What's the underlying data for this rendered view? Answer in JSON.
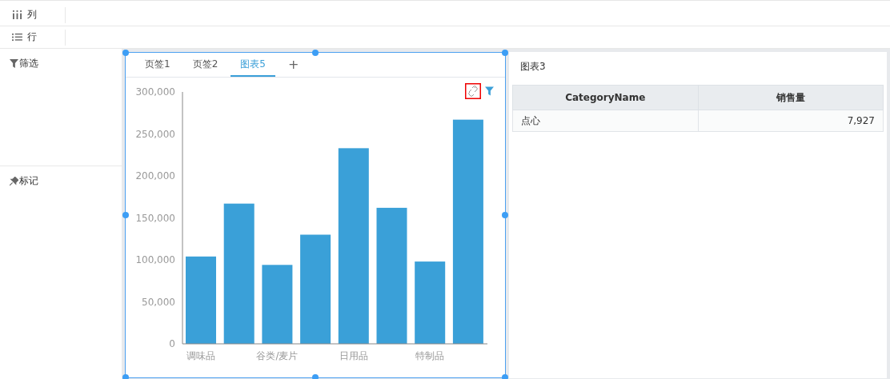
{
  "shelves": [
    {
      "kind": "columns",
      "label": "列"
    },
    {
      "kind": "rows",
      "label": "行"
    }
  ],
  "side_sections": [
    {
      "kind": "filter",
      "label": "筛选"
    },
    {
      "kind": "marks",
      "label": "标记"
    }
  ],
  "chart_panel": {
    "tabs": [
      {
        "label": "页签1",
        "selected": false
      },
      {
        "label": "页签2",
        "selected": false
      },
      {
        "label": "图表5",
        "selected": true
      }
    ],
    "add_tab": "+",
    "chart_data": {
      "type": "bar",
      "categories": [
        "调味品",
        null,
        "谷类/麦片",
        null,
        "日用品",
        null,
        "特制品",
        null
      ],
      "values": [
        104000,
        167000,
        94000,
        130000,
        233000,
        162000,
        98000,
        267000
      ],
      "ylim": [
        0,
        300000
      ],
      "yticks": [
        {
          "value": 0,
          "label": "0"
        },
        {
          "value": 50000,
          "label": "50,000"
        },
        {
          "value": 100000,
          "label": "100,000"
        },
        {
          "value": 150000,
          "label": "150,000"
        },
        {
          "value": 200000,
          "label": "200,000"
        },
        {
          "value": 250000,
          "label": "250,000"
        },
        {
          "value": 300000,
          "label": "300,000"
        }
      ]
    }
  },
  "table_panel": {
    "title": "图表3",
    "columns": [
      "CategoryName",
      "销售量"
    ],
    "rows": [
      [
        "点心",
        "7,927"
      ]
    ]
  }
}
